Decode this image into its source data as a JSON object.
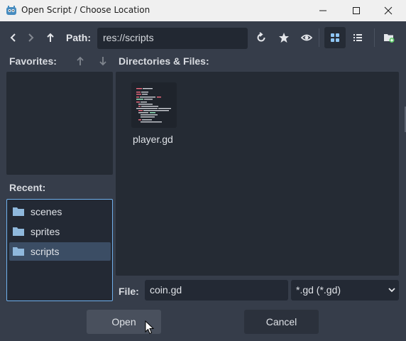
{
  "window": {
    "title": "Open Script / Choose Location",
    "icon": "godot-icon",
    "controls": [
      "minimize-icon",
      "maximize-icon",
      "close-icon"
    ]
  },
  "toolbar": {
    "path_label": "Path:",
    "path_value": "res://scripts",
    "icons": [
      "chevron-left-icon",
      "chevron-right-icon",
      "arrow-up-icon",
      "refresh-icon",
      "star-icon",
      "eye-icon",
      "grid-view-icon",
      "list-view-icon",
      "new-folder-icon"
    ]
  },
  "favorites": {
    "label": "Favorites:"
  },
  "recent": {
    "label": "Recent:",
    "items": [
      {
        "name": "scenes",
        "selected": false
      },
      {
        "name": "sprites",
        "selected": false
      },
      {
        "name": "scripts",
        "selected": true
      }
    ]
  },
  "directories": {
    "label": "Directories & Files:",
    "files": [
      {
        "name": "player.gd",
        "icon": "script-thumbnail"
      }
    ]
  },
  "file_row": {
    "label": "File:",
    "value": "coin.gd",
    "filter": "*.gd (*.gd)"
  },
  "buttons": {
    "open": "Open",
    "cancel": "Cancel"
  },
  "colors": {
    "background": "#363d4a",
    "panel": "#252b34",
    "selected": "#3b4d64",
    "focus_border": "#6fb0ec",
    "button": "#49505d",
    "godot_blue": "#478cbf"
  }
}
